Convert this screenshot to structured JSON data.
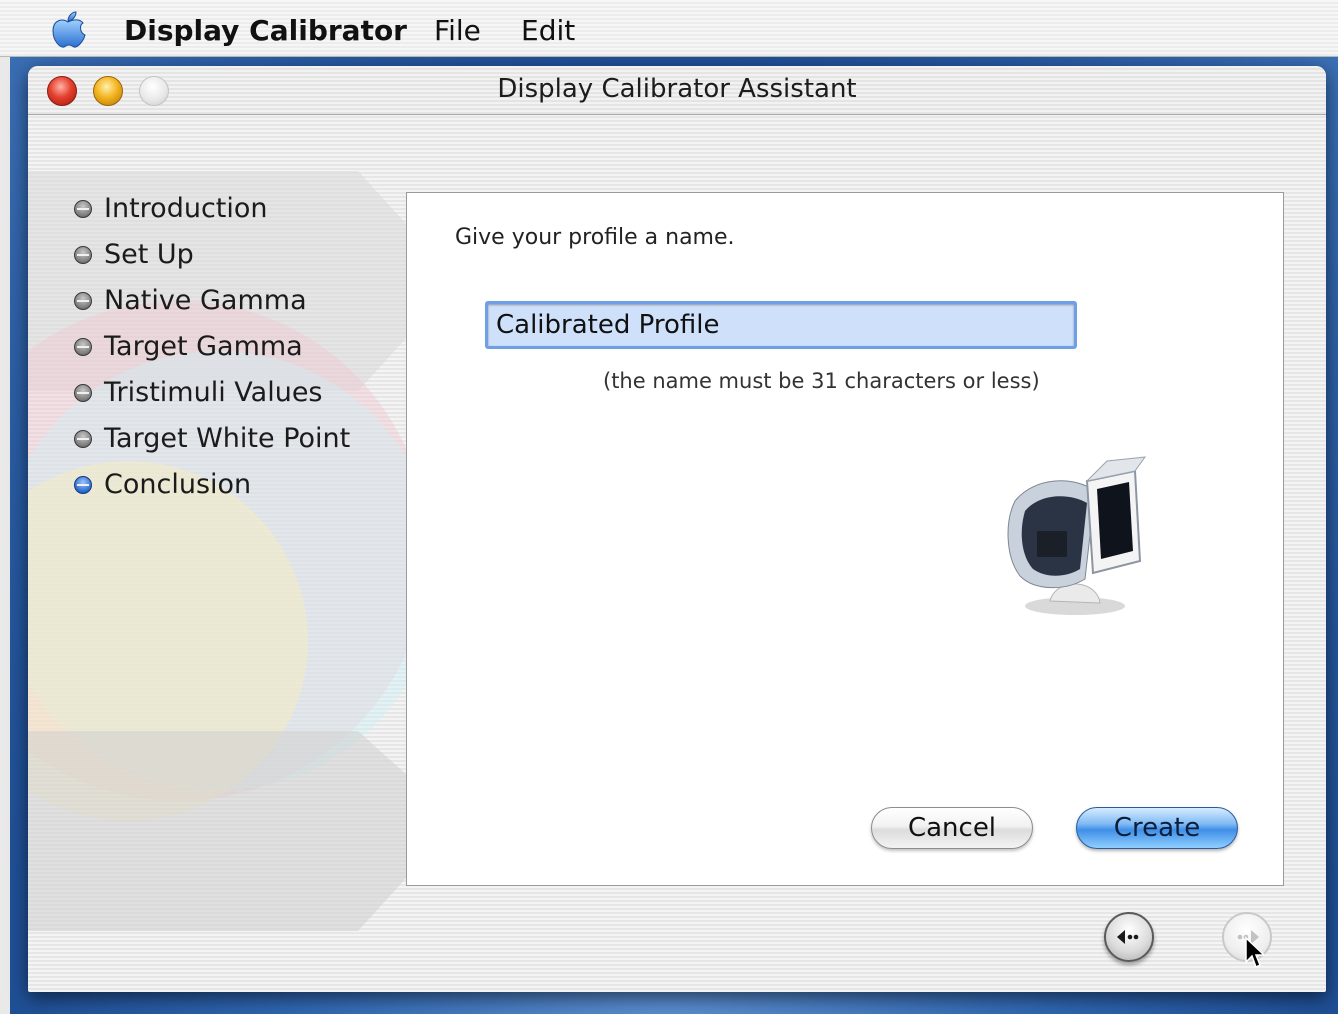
{
  "menubar": {
    "app_name": "Display Calibrator",
    "menus": [
      "File",
      "Edit"
    ]
  },
  "window": {
    "title": "Display Calibrator Assistant"
  },
  "steps": [
    {
      "label": "Introduction",
      "current": false
    },
    {
      "label": "Set Up",
      "current": false
    },
    {
      "label": "Native Gamma",
      "current": false
    },
    {
      "label": "Target Gamma",
      "current": false
    },
    {
      "label": "Tristimuli Values",
      "current": false
    },
    {
      "label": "Target White Point",
      "current": false
    },
    {
      "label": "Conclusion",
      "current": true
    }
  ],
  "panel": {
    "prompt": "Give your profile a name.",
    "profile_name_value": "Calibrated Profile",
    "hint": "(the name must be 31 characters or less)",
    "cancel_label": "Cancel",
    "create_label": "Create"
  },
  "icons": {
    "apple": "apple-menu-icon",
    "back": "back-arrow-icon",
    "forward": "forward-arrow-icon",
    "monitor": "monitor-illustration"
  },
  "colors": {
    "accent": "#3f8ee8",
    "close": "#e4402e",
    "minimize": "#f3b51f"
  }
}
